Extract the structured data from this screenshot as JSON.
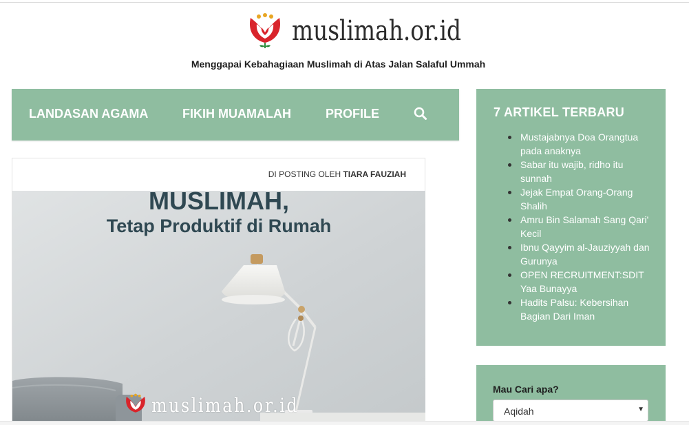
{
  "header": {
    "logo_text": "muslimah.or.id",
    "tagline": "Menggapai Kebahagiaan Muslimah di Atas Jalan Salaful Ummah"
  },
  "nav": {
    "items": [
      "LANDASAN AGAMA",
      "FIKIH MUAMALAH",
      "PROFILE"
    ],
    "search_icon": "search-icon"
  },
  "post": {
    "meta_prefix": "DI POSTING OLEH ",
    "author": "TIARA FAUZIAH",
    "image": {
      "title": "MUSLIMAH,",
      "subtitle": "Tetap Produktif di Rumah",
      "watermark": "muslimah.or.id"
    }
  },
  "sidebar": {
    "recent_title": "7 ARTIKEL TERBARU",
    "recent_items": [
      "Mustajabnya Doa Orangtua pada anaknya",
      "Sabar itu wajib, ridho itu sunnah",
      "Jejak Empat Orang-Orang Shalih",
      "Amru Bin Salamah Sang Qari' Kecil",
      "Ibnu Qayyim al-Jauziyyah dan Gurunya",
      "OPEN RECRUITMENT:SDIT Yaa Bunayya",
      "Hadits Palsu: Kebersihan Bagian Dari Iman"
    ],
    "search_widget": {
      "label": "Mau Cari apa?",
      "selected": "Aqidah"
    }
  },
  "colors": {
    "accent_green": "#8fbda0",
    "logo_red": "#d9242b",
    "logo_gold": "#e8a623",
    "image_text": "#2f4852"
  }
}
